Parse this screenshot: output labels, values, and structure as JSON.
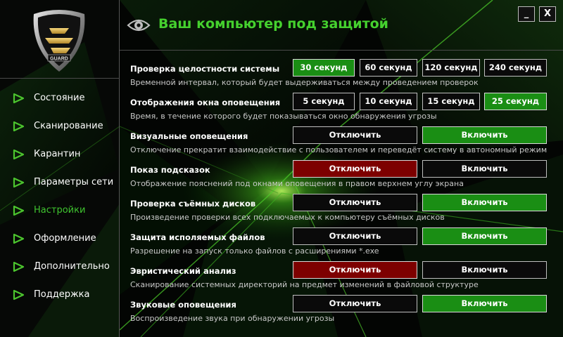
{
  "colors": {
    "accent": "#45d12e",
    "active_button": "#1a8e14",
    "off_button": "#7d0000",
    "background": "#000000"
  },
  "logo": {
    "text": "GUARD",
    "icon": "guard-shield-logo"
  },
  "window_controls": {
    "minimize": "_",
    "close": "X"
  },
  "header": {
    "title": "Ваш компьютер под защитой",
    "icon": "eye-icon"
  },
  "sidebar": {
    "items": [
      {
        "label": "Состояние",
        "active": false
      },
      {
        "label": "Сканирование",
        "active": false
      },
      {
        "label": "Карантин",
        "active": false
      },
      {
        "label": "Параметры сети",
        "active": false
      },
      {
        "label": "Настройки",
        "active": true
      },
      {
        "label": "Оформление",
        "active": false
      },
      {
        "label": "Дополнительно",
        "active": false
      },
      {
        "label": "Поддержка",
        "active": false
      }
    ]
  },
  "settings": {
    "rows": [
      {
        "label": "Проверка целостности системы",
        "description": "Временной интервал, который будет выдерживаться между проведением проверок",
        "options": [
          {
            "label": "30 секунд",
            "state": "selected"
          },
          {
            "label": "60 секунд",
            "state": "normal"
          },
          {
            "label": "120 секунд",
            "state": "normal"
          },
          {
            "label": "240 секунд",
            "state": "normal"
          }
        ]
      },
      {
        "label": "Отображения окна оповещения",
        "description": "Время, в течение которого будет показываться окно обнаружения угрозы",
        "options": [
          {
            "label": "5 секунд",
            "state": "normal"
          },
          {
            "label": "10 секунд",
            "state": "normal"
          },
          {
            "label": "15 секунд",
            "state": "normal"
          },
          {
            "label": "25 секунд",
            "state": "selected"
          }
        ]
      },
      {
        "label": "Визуальные оповещения",
        "description": "Отключение прекратит взаимодействие с пользователем и переведёт систему в автономный режим",
        "options": [
          {
            "label": "Отключить",
            "state": "normal"
          },
          {
            "label": "Включить",
            "state": "selected"
          }
        ]
      },
      {
        "label": "Показ подсказок",
        "description": "Отображение пояснений под окнами оповещения в правом верхнем углу экрана",
        "options": [
          {
            "label": "Отключить",
            "state": "off"
          },
          {
            "label": "Включить",
            "state": "normal"
          }
        ]
      },
      {
        "label": "Проверка съёмных дисков",
        "description": "Произведение проверки всех подключаемых к компьютеру съёмных дисков",
        "options": [
          {
            "label": "Отключить",
            "state": "normal"
          },
          {
            "label": "Включить",
            "state": "selected"
          }
        ]
      },
      {
        "label": "Защита исполяемых файлов",
        "description": "Разрешение на запуск только файлов с расширениями *.exe",
        "options": [
          {
            "label": "Отключить",
            "state": "normal"
          },
          {
            "label": "Включить",
            "state": "selected"
          }
        ]
      },
      {
        "label": "Эвристический анализ",
        "description": "Сканирование системных директорий на предмет изменений в файловой структуре",
        "options": [
          {
            "label": "Отключить",
            "state": "off"
          },
          {
            "label": "Включить",
            "state": "normal"
          }
        ]
      },
      {
        "label": "Звуковые оповещения",
        "description": "Воспроизведение звука при обнаружении угрозы",
        "options": [
          {
            "label": "Отключить",
            "state": "normal"
          },
          {
            "label": "Включить",
            "state": "selected"
          }
        ]
      }
    ]
  }
}
